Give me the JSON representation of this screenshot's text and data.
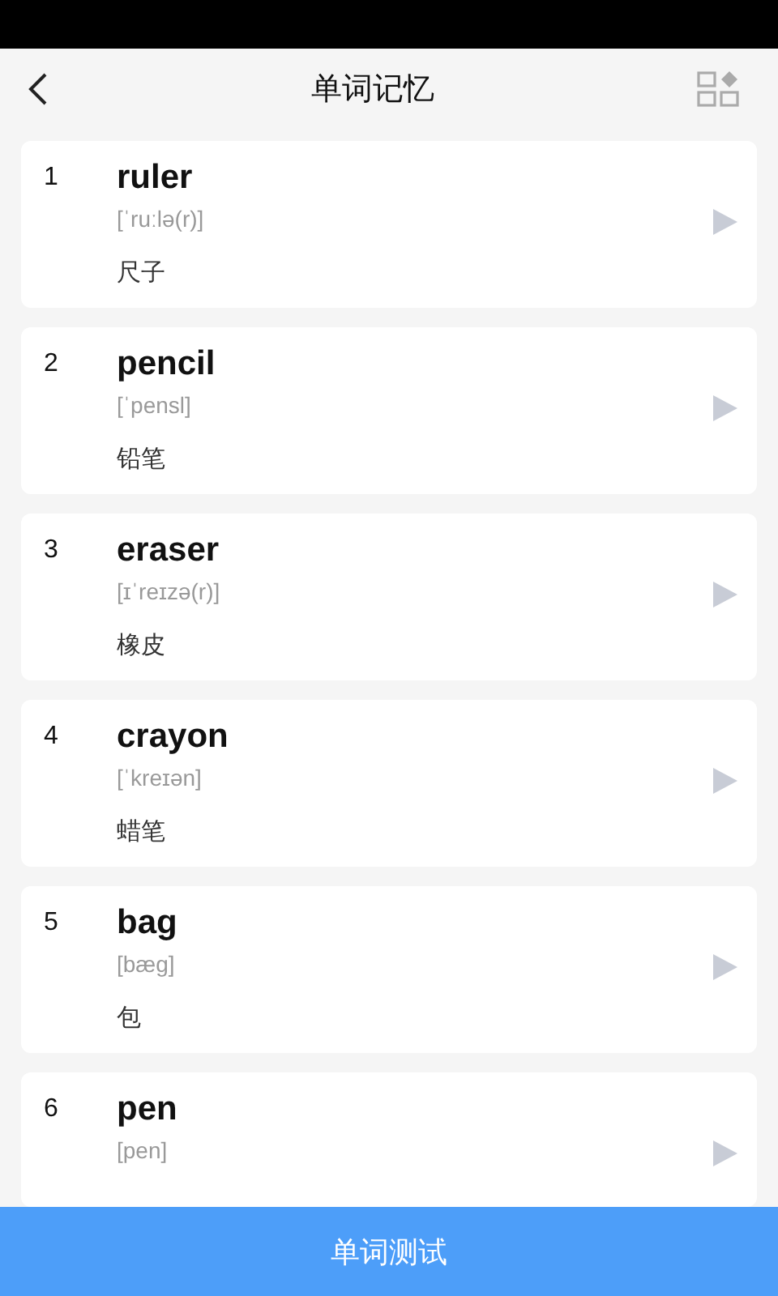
{
  "header": {
    "title": "单词记忆"
  },
  "words": [
    {
      "number": "1",
      "word": "ruler",
      "phonetic": "[ˈruːlə(r)]",
      "meaning": "尺子"
    },
    {
      "number": "2",
      "word": "pencil",
      "phonetic": "[ˈpensl]",
      "meaning": "铅笔"
    },
    {
      "number": "3",
      "word": "eraser",
      "phonetic": "[ɪˈreɪzə(r)]",
      "meaning": "橡皮"
    },
    {
      "number": "4",
      "word": "crayon",
      "phonetic": "[ˈkreɪən]",
      "meaning": "蜡笔"
    },
    {
      "number": "5",
      "word": "bag",
      "phonetic": "[bæg]",
      "meaning": "包"
    },
    {
      "number": "6",
      "word": "pen",
      "phonetic": "[pen]"
    }
  ],
  "bottom_button": "单词测试"
}
